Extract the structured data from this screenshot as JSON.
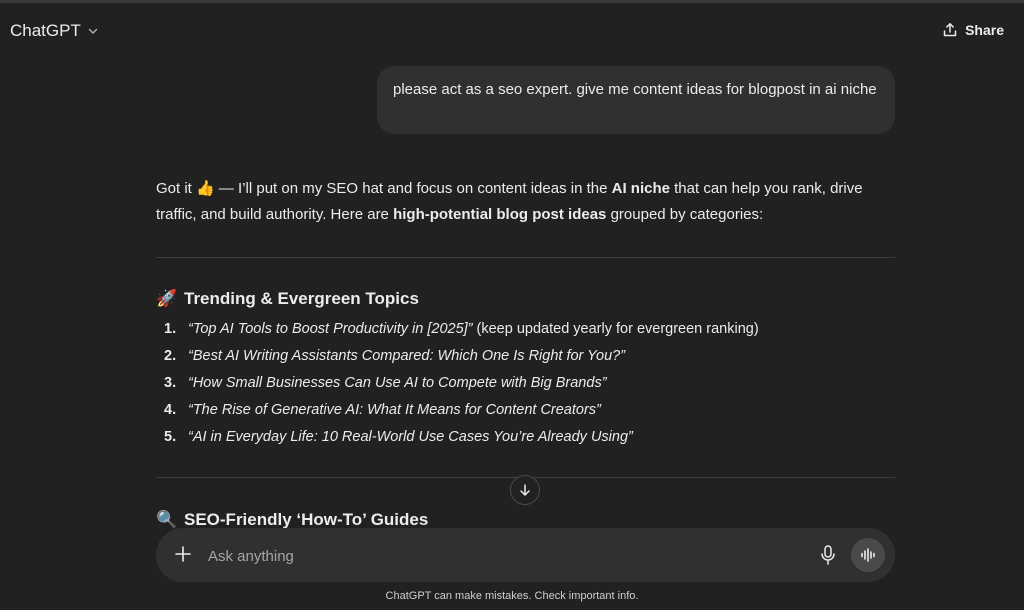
{
  "header": {
    "model_name": "ChatGPT",
    "share_label": "Share"
  },
  "user_message": "please act as a seo expert. give me content ideas for blogpost in ai niche",
  "reply": {
    "intro_part1": "Got it ",
    "intro_emoji": "👍",
    "intro_part2": " — I’ll put on my SEO hat and focus on content ideas in the ",
    "intro_bold1": "AI niche",
    "intro_part3": " that can help you rank, drive traffic, and build authority. Here are ",
    "intro_bold2": "high-potential blog post ideas",
    "intro_part4": " grouped by categories:",
    "section1": {
      "emoji": "🚀",
      "title": "Trending & Evergreen Topics",
      "items": [
        {
          "num": "1.",
          "title": "“Top AI Tools to Boost Productivity in [2025]”",
          "note": " (keep updated yearly for evergreen ranking)"
        },
        {
          "num": "2.",
          "title": "“Best AI Writing Assistants Compared: Which One Is Right for You?”",
          "note": ""
        },
        {
          "num": "3.",
          "title": "“How Small Businesses Can Use AI to Compete with Big Brands”",
          "note": ""
        },
        {
          "num": "4.",
          "title": "“The Rise of Generative AI: What It Means for Content Creators”",
          "note": ""
        },
        {
          "num": "5.",
          "title": "“AI in Everyday Life: 10 Real-World Use Cases You’re Already Using”",
          "note": ""
        }
      ]
    },
    "section2": {
      "emoji": "🔍",
      "title": "SEO-Friendly ‘How-To’ Guides"
    }
  },
  "composer": {
    "placeholder": "Ask anything"
  },
  "disclaimer": "ChatGPT can make mistakes. Check important info.",
  "icons": {
    "model_chevron": "chevron-down-icon",
    "share": "share-icon",
    "scroll": "arrow-down-icon",
    "plus": "plus-icon",
    "mic": "microphone-icon",
    "voice": "voice-mode-icon"
  }
}
